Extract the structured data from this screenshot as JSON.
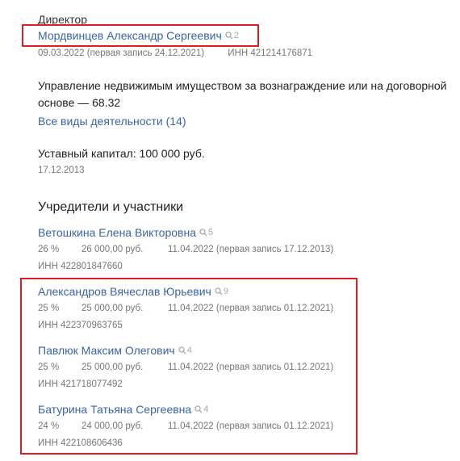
{
  "director": {
    "role": "Директор",
    "name": "Мордвинцев Александр Сергеевич",
    "count": "2",
    "date": "09.03.2022 (первая запись 24.12.2021)",
    "inn": "ИНН 421214176871"
  },
  "activity": {
    "line1": "Управление недвижимым имуществом за вознаграждение или на договорной",
    "line2": "основе — 68.32",
    "all_link": "Все виды деятельности (14)"
  },
  "capital": {
    "text": "Уставный капитал: 100 000 руб.",
    "date": "17.12.2013"
  },
  "founders": {
    "heading": "Учредители и участники",
    "items": [
      {
        "name": "Ветошкина Елена Викторовна",
        "count": "5",
        "share": "26 %",
        "amount": "26 000,00 руб.",
        "date": "11.04.2022 (первая запись 17.12.2013)",
        "inn": "ИНН 422801847660"
      },
      {
        "name": "Александров Вячеслав Юрьевич",
        "count": "9",
        "share": "25 %",
        "amount": "25 000,00 руб.",
        "date": "11.04.2022 (первая запись 01.12.2021)",
        "inn": "ИНН 422370963765"
      },
      {
        "name": "Павлюк Максим Олегович",
        "count": "4",
        "share": "25 %",
        "amount": "25 000,00 руб.",
        "date": "11.04.2022 (первая запись 01.12.2021)",
        "inn": "ИНН 421718077492"
      },
      {
        "name": "Батурина Татьяна Сергеевна",
        "count": "4",
        "share": "24 %",
        "amount": "24 000,00 руб.",
        "date": "11.04.2022 (первая запись 01.12.2021)",
        "inn": "ИНН 422108606436"
      }
    ]
  },
  "colors": {
    "link": "#3a64a8",
    "highlight": "#e01c24",
    "muted": "#777777"
  },
  "icons": {
    "count_icon": "search-icon"
  }
}
